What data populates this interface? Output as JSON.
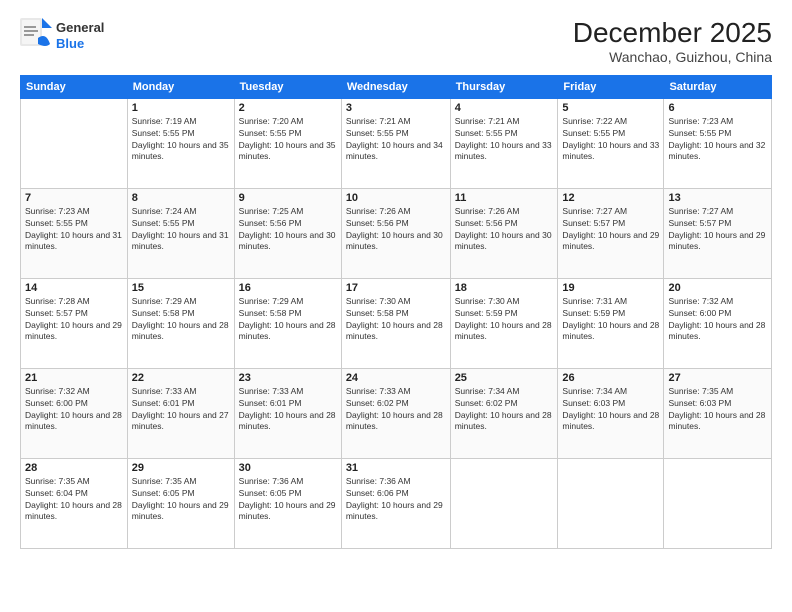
{
  "logo": {
    "general": "General",
    "blue": "Blue"
  },
  "header": {
    "month": "December 2025",
    "location": "Wanchao, Guizhou, China"
  },
  "weekdays": [
    "Sunday",
    "Monday",
    "Tuesday",
    "Wednesday",
    "Thursday",
    "Friday",
    "Saturday"
  ],
  "weeks": [
    [
      {
        "day": "",
        "sunrise": "",
        "sunset": "",
        "daylight": ""
      },
      {
        "day": "1",
        "sunrise": "Sunrise: 7:19 AM",
        "sunset": "Sunset: 5:55 PM",
        "daylight": "Daylight: 10 hours and 35 minutes."
      },
      {
        "day": "2",
        "sunrise": "Sunrise: 7:20 AM",
        "sunset": "Sunset: 5:55 PM",
        "daylight": "Daylight: 10 hours and 35 minutes."
      },
      {
        "day": "3",
        "sunrise": "Sunrise: 7:21 AM",
        "sunset": "Sunset: 5:55 PM",
        "daylight": "Daylight: 10 hours and 34 minutes."
      },
      {
        "day": "4",
        "sunrise": "Sunrise: 7:21 AM",
        "sunset": "Sunset: 5:55 PM",
        "daylight": "Daylight: 10 hours and 33 minutes."
      },
      {
        "day": "5",
        "sunrise": "Sunrise: 7:22 AM",
        "sunset": "Sunset: 5:55 PM",
        "daylight": "Daylight: 10 hours and 33 minutes."
      },
      {
        "day": "6",
        "sunrise": "Sunrise: 7:23 AM",
        "sunset": "Sunset: 5:55 PM",
        "daylight": "Daylight: 10 hours and 32 minutes."
      }
    ],
    [
      {
        "day": "7",
        "sunrise": "Sunrise: 7:23 AM",
        "sunset": "Sunset: 5:55 PM",
        "daylight": "Daylight: 10 hours and 31 minutes."
      },
      {
        "day": "8",
        "sunrise": "Sunrise: 7:24 AM",
        "sunset": "Sunset: 5:55 PM",
        "daylight": "Daylight: 10 hours and 31 minutes."
      },
      {
        "day": "9",
        "sunrise": "Sunrise: 7:25 AM",
        "sunset": "Sunset: 5:56 PM",
        "daylight": "Daylight: 10 hours and 30 minutes."
      },
      {
        "day": "10",
        "sunrise": "Sunrise: 7:26 AM",
        "sunset": "Sunset: 5:56 PM",
        "daylight": "Daylight: 10 hours and 30 minutes."
      },
      {
        "day": "11",
        "sunrise": "Sunrise: 7:26 AM",
        "sunset": "Sunset: 5:56 PM",
        "daylight": "Daylight: 10 hours and 30 minutes."
      },
      {
        "day": "12",
        "sunrise": "Sunrise: 7:27 AM",
        "sunset": "Sunset: 5:57 PM",
        "daylight": "Daylight: 10 hours and 29 minutes."
      },
      {
        "day": "13",
        "sunrise": "Sunrise: 7:27 AM",
        "sunset": "Sunset: 5:57 PM",
        "daylight": "Daylight: 10 hours and 29 minutes."
      }
    ],
    [
      {
        "day": "14",
        "sunrise": "Sunrise: 7:28 AM",
        "sunset": "Sunset: 5:57 PM",
        "daylight": "Daylight: 10 hours and 29 minutes."
      },
      {
        "day": "15",
        "sunrise": "Sunrise: 7:29 AM",
        "sunset": "Sunset: 5:58 PM",
        "daylight": "Daylight: 10 hours and 28 minutes."
      },
      {
        "day": "16",
        "sunrise": "Sunrise: 7:29 AM",
        "sunset": "Sunset: 5:58 PM",
        "daylight": "Daylight: 10 hours and 28 minutes."
      },
      {
        "day": "17",
        "sunrise": "Sunrise: 7:30 AM",
        "sunset": "Sunset: 5:58 PM",
        "daylight": "Daylight: 10 hours and 28 minutes."
      },
      {
        "day": "18",
        "sunrise": "Sunrise: 7:30 AM",
        "sunset": "Sunset: 5:59 PM",
        "daylight": "Daylight: 10 hours and 28 minutes."
      },
      {
        "day": "19",
        "sunrise": "Sunrise: 7:31 AM",
        "sunset": "Sunset: 5:59 PM",
        "daylight": "Daylight: 10 hours and 28 minutes."
      },
      {
        "day": "20",
        "sunrise": "Sunrise: 7:32 AM",
        "sunset": "Sunset: 6:00 PM",
        "daylight": "Daylight: 10 hours and 28 minutes."
      }
    ],
    [
      {
        "day": "21",
        "sunrise": "Sunrise: 7:32 AM",
        "sunset": "Sunset: 6:00 PM",
        "daylight": "Daylight: 10 hours and 28 minutes."
      },
      {
        "day": "22",
        "sunrise": "Sunrise: 7:33 AM",
        "sunset": "Sunset: 6:01 PM",
        "daylight": "Daylight: 10 hours and 27 minutes."
      },
      {
        "day": "23",
        "sunrise": "Sunrise: 7:33 AM",
        "sunset": "Sunset: 6:01 PM",
        "daylight": "Daylight: 10 hours and 28 minutes."
      },
      {
        "day": "24",
        "sunrise": "Sunrise: 7:33 AM",
        "sunset": "Sunset: 6:02 PM",
        "daylight": "Daylight: 10 hours and 28 minutes."
      },
      {
        "day": "25",
        "sunrise": "Sunrise: 7:34 AM",
        "sunset": "Sunset: 6:02 PM",
        "daylight": "Daylight: 10 hours and 28 minutes."
      },
      {
        "day": "26",
        "sunrise": "Sunrise: 7:34 AM",
        "sunset": "Sunset: 6:03 PM",
        "daylight": "Daylight: 10 hours and 28 minutes."
      },
      {
        "day": "27",
        "sunrise": "Sunrise: 7:35 AM",
        "sunset": "Sunset: 6:03 PM",
        "daylight": "Daylight: 10 hours and 28 minutes."
      }
    ],
    [
      {
        "day": "28",
        "sunrise": "Sunrise: 7:35 AM",
        "sunset": "Sunset: 6:04 PM",
        "daylight": "Daylight: 10 hours and 28 minutes."
      },
      {
        "day": "29",
        "sunrise": "Sunrise: 7:35 AM",
        "sunset": "Sunset: 6:05 PM",
        "daylight": "Daylight: 10 hours and 29 minutes."
      },
      {
        "day": "30",
        "sunrise": "Sunrise: 7:36 AM",
        "sunset": "Sunset: 6:05 PM",
        "daylight": "Daylight: 10 hours and 29 minutes."
      },
      {
        "day": "31",
        "sunrise": "Sunrise: 7:36 AM",
        "sunset": "Sunset: 6:06 PM",
        "daylight": "Daylight: 10 hours and 29 minutes."
      },
      {
        "day": "",
        "sunrise": "",
        "sunset": "",
        "daylight": ""
      },
      {
        "day": "",
        "sunrise": "",
        "sunset": "",
        "daylight": ""
      },
      {
        "day": "",
        "sunrise": "",
        "sunset": "",
        "daylight": ""
      }
    ]
  ]
}
